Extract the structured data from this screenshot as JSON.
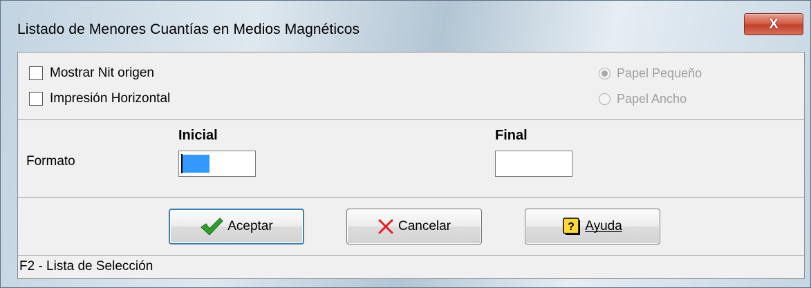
{
  "window": {
    "title": "Listado de Menores Cuantías en Medios Magnéticos",
    "close_label": "X"
  },
  "options": {
    "checkboxes": [
      {
        "label": "Mostrar Nit origen",
        "checked": false
      },
      {
        "label": "Impresión Horizontal",
        "checked": false
      }
    ],
    "paper": [
      {
        "label": "Papel Pequeño",
        "selected": true,
        "enabled": false
      },
      {
        "label": "Papel Ancho",
        "selected": false,
        "enabled": false
      }
    ]
  },
  "format": {
    "row_label": "Formato",
    "initial_header": "Inicial",
    "final_header": "Final",
    "initial_value": "",
    "final_value": ""
  },
  "buttons": {
    "accept": "Aceptar",
    "cancel": "Cancelar",
    "help": "Ayuda"
  },
  "status": {
    "text": "F2 - Lista de Selección"
  },
  "colors": {
    "accept_icon": "#2e9e2e",
    "cancel_icon": "#e02020",
    "help_icon_bg": "#ffd93a",
    "selection": "#3399ff"
  }
}
